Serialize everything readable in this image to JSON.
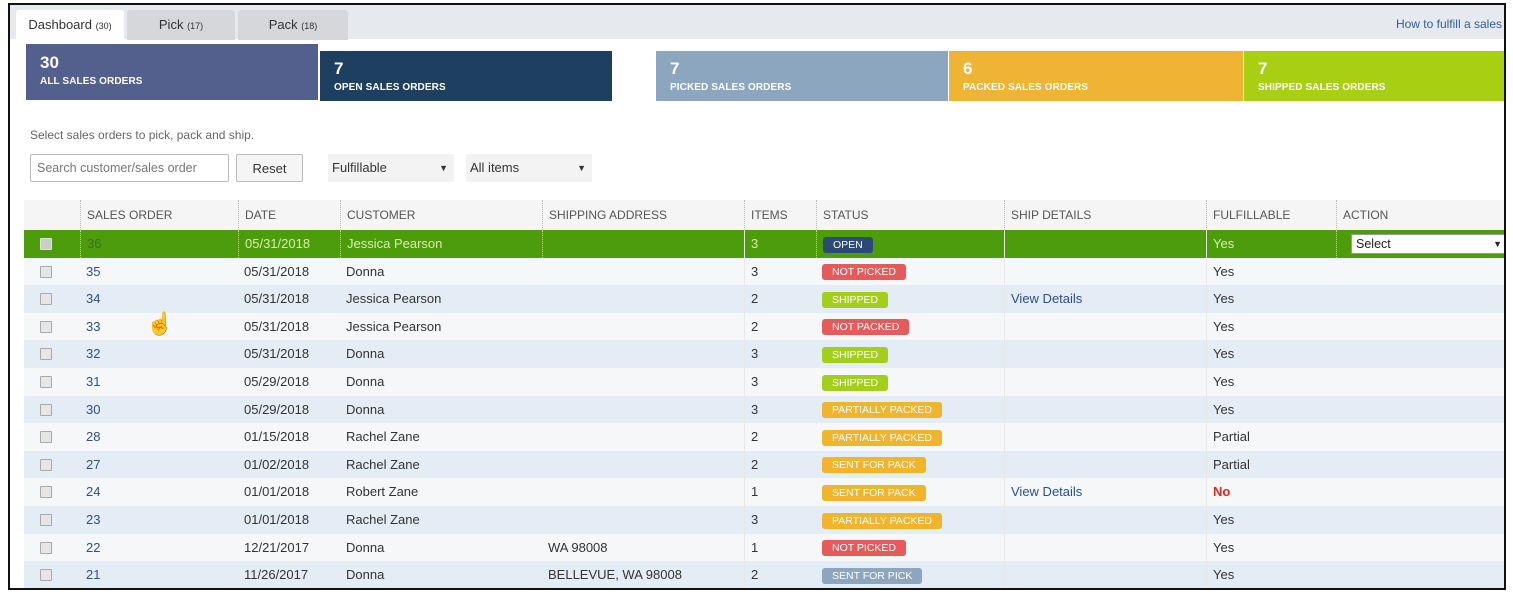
{
  "tabs": [
    {
      "label": "Dashboard",
      "count": "(30)",
      "active": true
    },
    {
      "label": "Pick",
      "count": "(17)",
      "active": false
    },
    {
      "label": "Pack",
      "count": "(18)",
      "active": false
    }
  ],
  "help_link": "How to fulfill a sales",
  "cards": [
    {
      "count": "30",
      "label": "ALL SALES ORDERS",
      "color": "#535f8c"
    },
    {
      "count": "7",
      "label": "OPEN SALES ORDERS",
      "color": "#1f3f60"
    },
    {
      "count": "7",
      "label": "PICKED SALES ORDERS",
      "color": "#8ca6c0"
    },
    {
      "count": "6",
      "label": "PACKED SALES ORDERS",
      "color": "#f0b435"
    },
    {
      "count": "7",
      "label": "SHIPPED SALES ORDERS",
      "color": "#a8cf12"
    }
  ],
  "hint": "Select sales orders to pick, pack and ship.",
  "filters": {
    "search_placeholder": "Search customer/sales order",
    "reset_label": "Reset",
    "fulfillable_value": "Fulfillable",
    "items_value": "All items"
  },
  "columns": [
    "",
    "SALES ORDER",
    "DATE",
    "CUSTOMER",
    "SHIPPING ADDRESS",
    "ITEMS",
    "STATUS",
    "SHIP DETAILS",
    "FULFILLABLE",
    "ACTION"
  ],
  "status_colors": {
    "OPEN": "#2b4a7a",
    "NOT PICKED": "#e55b5b",
    "SHIPPED": "#a3cf1c",
    "NOT PACKED": "#e55b5b",
    "PARTIALLY PACKED": "#f0b42d",
    "SENT FOR PACK": "#f0b42d",
    "SENT FOR PICK": "#8ea6bd"
  },
  "rows": [
    {
      "so": "36",
      "date": "05/31/2018",
      "customer": "Jessica Pearson",
      "address": "",
      "items": "3",
      "status": "OPEN",
      "ship": "",
      "fulfillable": "Yes",
      "action": "Select",
      "selected": true
    },
    {
      "so": "35",
      "date": "05/31/2018",
      "customer": "Donna",
      "address": "",
      "items": "3",
      "status": "NOT PICKED",
      "ship": "",
      "fulfillable": "Yes"
    },
    {
      "so": "34",
      "date": "05/31/2018",
      "customer": "Jessica Pearson",
      "address": "",
      "items": "2",
      "status": "SHIPPED",
      "ship": "View Details",
      "fulfillable": "Yes"
    },
    {
      "so": "33",
      "date": "05/31/2018",
      "customer": "Jessica Pearson",
      "address": "",
      "items": "2",
      "status": "NOT PACKED",
      "ship": "",
      "fulfillable": "Yes"
    },
    {
      "so": "32",
      "date": "05/31/2018",
      "customer": "Donna",
      "address": "",
      "items": "3",
      "status": "SHIPPED",
      "ship": "",
      "fulfillable": "Yes"
    },
    {
      "so": "31",
      "date": "05/29/2018",
      "customer": "Donna",
      "address": "",
      "items": "3",
      "status": "SHIPPED",
      "ship": "",
      "fulfillable": "Yes"
    },
    {
      "so": "30",
      "date": "05/29/2018",
      "customer": "Donna",
      "address": "",
      "items": "3",
      "status": "PARTIALLY PACKED",
      "ship": "",
      "fulfillable": "Yes"
    },
    {
      "so": "28",
      "date": "01/15/2018",
      "customer": "Rachel Zane",
      "address": "",
      "items": "2",
      "status": "PARTIALLY PACKED",
      "ship": "",
      "fulfillable": "Partial"
    },
    {
      "so": "27",
      "date": "01/02/2018",
      "customer": "Rachel Zane",
      "address": "",
      "items": "2",
      "status": "SENT FOR PACK",
      "ship": "",
      "fulfillable": "Partial"
    },
    {
      "so": "24",
      "date": "01/01/2018",
      "customer": "Robert Zane",
      "address": "",
      "items": "1",
      "status": "SENT FOR PACK",
      "ship": "View Details",
      "fulfillable": "No"
    },
    {
      "so": "23",
      "date": "01/01/2018",
      "customer": "Rachel Zane",
      "address": "",
      "items": "3",
      "status": "PARTIALLY PACKED",
      "ship": "",
      "fulfillable": "Yes"
    },
    {
      "so": "22",
      "date": "12/21/2017",
      "customer": "Donna",
      "address": "WA 98008",
      "items": "1",
      "status": "NOT PICKED",
      "ship": "",
      "fulfillable": "Yes"
    },
    {
      "so": "21",
      "date": "11/26/2017",
      "customer": "Donna",
      "address": "BELLEVUE, WA 98008",
      "items": "2",
      "status": "SENT FOR PICK",
      "ship": "",
      "fulfillable": "Yes"
    }
  ]
}
